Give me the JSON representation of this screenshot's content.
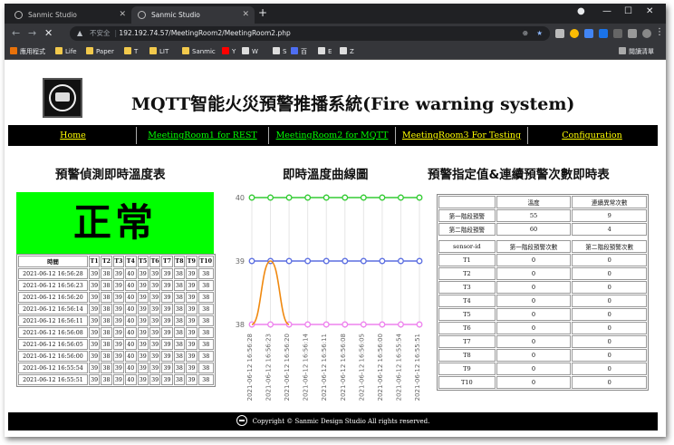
{
  "browser": {
    "tabs": [
      {
        "title": "Sanmic Studio",
        "active": false
      },
      {
        "title": "Sanmic Studio",
        "active": true
      }
    ],
    "new_tab": "+",
    "security_label": "不安全",
    "url": "192.192.74.57/MeetingRoom2/MeetingRoom2.php",
    "bookmarks": [
      {
        "label": "應用程式",
        "icon": "apps-grid-icon",
        "color": "#e8710a"
      },
      {
        "label": "Life",
        "icon": "folder-icon",
        "color": "#f2c94c"
      },
      {
        "label": "Paper",
        "icon": "folder-icon",
        "color": "#f2c94c"
      },
      {
        "label": "T",
        "icon": "folder-icon",
        "color": "#f2c94c"
      },
      {
        "label": "LIT",
        "icon": "folder-icon",
        "color": "#f2c94c"
      },
      {
        "label": "Sanmic",
        "icon": "folder-icon",
        "color": "#f2c94c"
      },
      {
        "label": "Y",
        "icon": "youtube-icon",
        "color": "#ff0000"
      },
      {
        "label": "W",
        "icon": "wikipedia-icon",
        "color": "#dddddd"
      },
      {
        "label": "S",
        "icon": "s-icon",
        "color": "#dddddd"
      },
      {
        "label": "百",
        "icon": "baidu-icon",
        "color": "#4e6ef2"
      },
      {
        "label": "E",
        "icon": "w-box-icon",
        "color": "#dddddd"
      },
      {
        "label": "Z",
        "icon": "w-box-icon",
        "color": "#dddddd"
      }
    ],
    "reading_list": "閱讀清單"
  },
  "site": {
    "title": "MQTT智能火災預警推播系統(Fire warning system)",
    "nav": [
      {
        "label": "Home",
        "color": "#ffff00"
      },
      {
        "label": "MeetingRoom1 for REST",
        "color": "#00ff00"
      },
      {
        "label": "MeetingRoom2 for MQTT",
        "color": "#00ff00"
      },
      {
        "label": "MeetingRoom3 For Testing",
        "color": "#ffff00"
      },
      {
        "label": "Configuration",
        "color": "#ffff00"
      }
    ],
    "footer": "Copyright © Sanmic Design Studio All rights reserved."
  },
  "left": {
    "heading": "預警偵測即時溫度表",
    "status": "正常",
    "status_color": "#00ff00",
    "columns": [
      "時間",
      "T1",
      "T2",
      "T3",
      "T4",
      "T5",
      "T6",
      "T7",
      "T8",
      "T9",
      "T10"
    ],
    "rows": [
      [
        "2021-06-12 16:56:28",
        "39",
        "38",
        "39",
        "40",
        "39",
        "39",
        "39",
        "38",
        "39",
        "38"
      ],
      [
        "2021-06-12 16:56:23",
        "39",
        "38",
        "39",
        "40",
        "39",
        "39",
        "39",
        "38",
        "39",
        "38"
      ],
      [
        "2021-06-12 16:56:20",
        "39",
        "38",
        "39",
        "40",
        "39",
        "39",
        "39",
        "38",
        "39",
        "38"
      ],
      [
        "2021-06-12 16:56:14",
        "39",
        "38",
        "39",
        "40",
        "39",
        "39",
        "39",
        "38",
        "39",
        "38"
      ],
      [
        "2021-06-12 16:56:11",
        "39",
        "38",
        "39",
        "40",
        "39",
        "39",
        "39",
        "38",
        "39",
        "38"
      ],
      [
        "2021-06-12 16:56:08",
        "39",
        "38",
        "39",
        "40",
        "39",
        "39",
        "39",
        "38",
        "39",
        "38"
      ],
      [
        "2021-06-12 16:56:05",
        "39",
        "38",
        "39",
        "40",
        "39",
        "39",
        "39",
        "38",
        "39",
        "38"
      ],
      [
        "2021-06-12 16:56:00",
        "39",
        "38",
        "39",
        "40",
        "39",
        "39",
        "39",
        "38",
        "39",
        "38"
      ],
      [
        "2021-06-12 16:55:54",
        "39",
        "38",
        "39",
        "40",
        "39",
        "39",
        "39",
        "38",
        "39",
        "38"
      ],
      [
        "2021-06-12 16:55:51",
        "39",
        "38",
        "39",
        "40",
        "39",
        "39",
        "39",
        "38",
        "39",
        "38"
      ]
    ]
  },
  "middle": {
    "heading": "即時溫度曲線圖"
  },
  "chart_data": {
    "type": "line",
    "title": "",
    "xlabel": "",
    "ylabel": "",
    "ylim": [
      38,
      40
    ],
    "yticks": [
      "38",
      "39",
      "40"
    ],
    "categories": [
      "2021-06-12 16:56:28",
      "2021-06-12 16:56:23",
      "2021-06-12 16:56:20",
      "2021-06-12 16:56:14",
      "2021-06-12 16:56:11",
      "2021-06-12 16:56:08",
      "2021-06-12 16:56:05",
      "2021-06-12 16:56:00",
      "2021-06-12 16:55:54",
      "2021-06-12 16:55:51"
    ],
    "grid": true,
    "legend": "none",
    "series": [
      {
        "color": "#33cc33",
        "values": [
          40,
          40,
          40,
          40,
          40,
          40,
          40,
          40,
          40,
          40
        ]
      },
      {
        "color": "#5b6ee1",
        "values": [
          39,
          39,
          39,
          39,
          39,
          39,
          39,
          39,
          39,
          39
        ]
      },
      {
        "color": "#ee82ee",
        "values": [
          38,
          38,
          38,
          38,
          38,
          38,
          38,
          38,
          38,
          38
        ]
      },
      {
        "color": "#f0890f",
        "values": [
          38,
          39,
          38,
          38,
          38,
          38,
          38,
          38,
          38,
          38
        ],
        "smooth": true,
        "end_index": 2
      }
    ]
  },
  "right": {
    "heading": "預警指定值&連續預警次數即時表",
    "settings_columns": [
      "",
      "溫度",
      "連續異常次數"
    ],
    "settings_rows": [
      [
        "第一階段預警",
        "55",
        "9"
      ],
      [
        "第二階段預警",
        "60",
        "4"
      ]
    ],
    "count_columns": [
      "sensor-id",
      "第一階段預警次數",
      "第二階段預警次數"
    ],
    "count_rows": [
      [
        "T1",
        "0",
        "0"
      ],
      [
        "T2",
        "0",
        "0"
      ],
      [
        "T3",
        "0",
        "0"
      ],
      [
        "T4",
        "0",
        "0"
      ],
      [
        "T5",
        "0",
        "0"
      ],
      [
        "T6",
        "0",
        "0"
      ],
      [
        "T7",
        "0",
        "0"
      ],
      [
        "T8",
        "0",
        "0"
      ],
      [
        "T9",
        "0",
        "0"
      ],
      [
        "T10",
        "0",
        "0"
      ]
    ]
  }
}
